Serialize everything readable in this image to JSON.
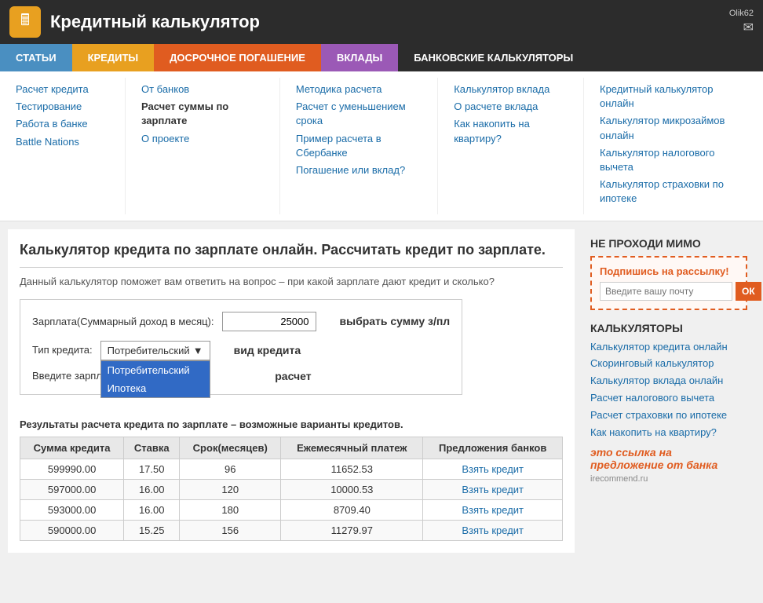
{
  "header": {
    "icon": "🖩",
    "title": "Кредитный калькулятор",
    "username": "Olik62",
    "email_icon": "✉"
  },
  "navbar": {
    "items": [
      {
        "key": "articles",
        "label": "СТАТЬИ",
        "class": "articles"
      },
      {
        "key": "credits",
        "label": "КРЕДИТЫ",
        "class": "credits"
      },
      {
        "key": "early",
        "label": "ДОСРОЧНОЕ ПОГАШЕНИЕ",
        "class": "early"
      },
      {
        "key": "deposits",
        "label": "ВКЛАДЫ",
        "class": "deposits"
      },
      {
        "key": "bank-calc",
        "label": "БАНКОВСКИЕ КАЛЬКУЛЯТОРЫ",
        "class": "bank-calc"
      }
    ]
  },
  "mega_menu": {
    "columns": [
      {
        "links": [
          {
            "text": "Расчет кредита",
            "bold": false
          },
          {
            "text": "Тестирование",
            "bold": false
          },
          {
            "text": "Работа в банке",
            "bold": false
          },
          {
            "text": "Battle Nations",
            "bold": false
          }
        ]
      },
      {
        "links": [
          {
            "text": "От банков",
            "bold": false
          },
          {
            "text": "Расчет суммы по зарплате",
            "bold": true
          },
          {
            "text": "О проекте",
            "bold": false
          }
        ]
      },
      {
        "links": [
          {
            "text": "Методика расчета",
            "bold": false
          },
          {
            "text": "Расчет с уменьшением срока",
            "bold": false
          },
          {
            "text": "Пример расчета в Сбербанке",
            "bold": false
          },
          {
            "text": "Погашение или вклад?",
            "bold": false
          }
        ]
      },
      {
        "links": [
          {
            "text": "Калькулятор вклада",
            "bold": false
          },
          {
            "text": "О расчете вклада",
            "bold": false
          },
          {
            "text": "Как накопить на квартиру?",
            "bold": false
          }
        ]
      },
      {
        "links": [
          {
            "text": "Кредитный калькулятор онлайн",
            "bold": false
          },
          {
            "text": "Калькулятор микрозаймов онлайн",
            "bold": false
          },
          {
            "text": "Калькулятор налогового вычета",
            "bold": false
          },
          {
            "text": "Калькулятор страховки по ипотеке",
            "bold": false
          }
        ]
      }
    ]
  },
  "calculator": {
    "title": "Калькулятор кредита по зарплате онлайн. Рассчитать кредит по зарплате.",
    "description": "Данный калькулятор поможет вам ответить на вопрос – при какой зарплате дают кредит и сколько?",
    "salary_label": "Зарплата(Суммарный доход в месяц):",
    "salary_value": "25000",
    "salary_hint": "выбрать сумму з/пл",
    "credit_type_label": "Тип кредита:",
    "credit_type_hint": "вид кредита",
    "credit_type_value": "Потребительский",
    "credit_type_options": [
      "Потребительский",
      "Ипотека"
    ],
    "enter_note": "Введите зарплату и нажмите расчет",
    "enter_hint": "расчет",
    "results_title": "Результаты расчета кредита по зарплате – возможные варианты кредитов."
  },
  "table": {
    "headers": [
      "Сумма кредита",
      "Ставка",
      "Срок(месяцев)",
      "Ежемесячный платеж",
      "Предложения банков"
    ],
    "rows": [
      {
        "sum": "599990.00",
        "rate": "17.50",
        "term": "96",
        "payment": "11652.53",
        "link": "Взять кредит"
      },
      {
        "sum": "597000.00",
        "rate": "16.00",
        "term": "120",
        "payment": "10000.53",
        "link": "Взять кредит"
      },
      {
        "sum": "593000.00",
        "rate": "16.00",
        "term": "180",
        "payment": "8709.40",
        "link": "Взять кредит"
      },
      {
        "sum": "590000.00",
        "rate": "15.25",
        "term": "156",
        "payment": "11279.97",
        "link": "Взять кредит"
      }
    ]
  },
  "sidebar": {
    "newsletter": {
      "heading": "НЕ ПРОХОДИ МИМО",
      "box_title": "Подпишись на рассылку!",
      "placeholder": "Введите вашу почту",
      "button": "ОК"
    },
    "calculators": {
      "heading": "КАЛЬКУЛЯТОРЫ",
      "links": [
        "Калькулятор кредита онлайн",
        "Скоринговый калькулятор",
        "Калькулятор вклада онлайн",
        "Расчет налогового вычета",
        "Расчет страховки по ипотеке",
        "Как накопить на квартиру?"
      ]
    }
  },
  "overlay": {
    "note": "это ссылка на предложение от банка",
    "watermark": "irecommend.ru"
  }
}
